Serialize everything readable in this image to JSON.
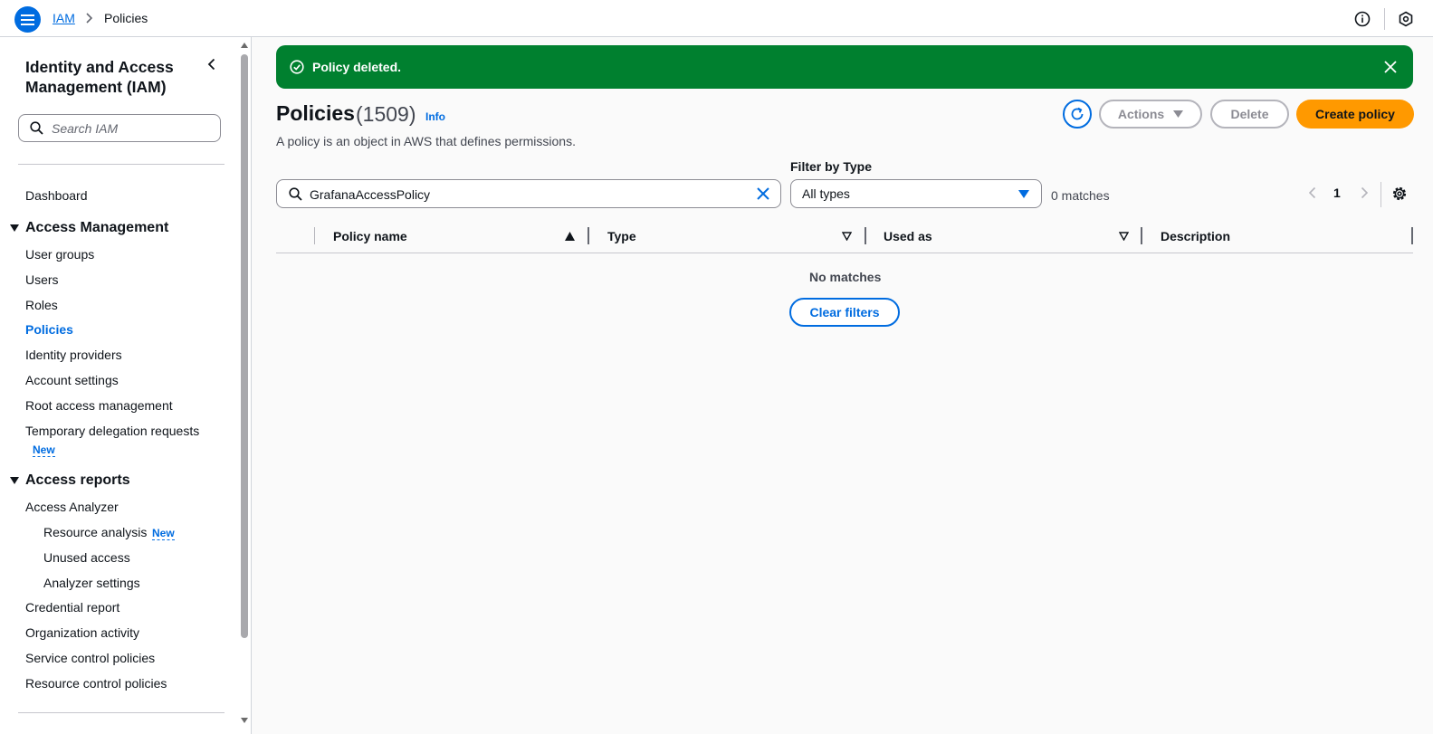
{
  "topbar": {
    "breadcrumb_root": "IAM",
    "breadcrumb_current": "Policies"
  },
  "sidebar": {
    "title": "Identity and Access Management (IAM)",
    "search_placeholder": "Search IAM",
    "dashboard": "Dashboard",
    "access_management": {
      "label": "Access Management",
      "items": [
        "User groups",
        "Users",
        "Roles",
        "Policies",
        "Identity providers",
        "Account settings",
        "Root access management",
        "Temporary delegation requests"
      ],
      "active": "Policies",
      "new_badge": "New"
    },
    "access_reports": {
      "label": "Access reports",
      "analyzer": "Access Analyzer",
      "analyzer_items": [
        "Resource analysis",
        "Unused access",
        "Analyzer settings"
      ],
      "new_badge": "New",
      "items": [
        "Credential report",
        "Organization activity",
        "Service control policies",
        "Resource control policies"
      ]
    }
  },
  "flash": {
    "message": "Policy deleted.",
    "type": "success",
    "color": "#00802f"
  },
  "header": {
    "title": "Policies",
    "count": "(1509)",
    "info": "Info",
    "description": "A policy is an object in AWS that defines permissions.",
    "actions_label": "Actions",
    "delete_label": "Delete",
    "create_label": "Create policy"
  },
  "filter": {
    "search_value": "GrafanaAccessPolicy",
    "type_label": "Filter by Type",
    "type_value": "All types",
    "matches": "0 matches",
    "page": "1"
  },
  "table": {
    "columns": [
      "Policy name",
      "Type",
      "Used as",
      "Description"
    ],
    "empty_text": "No matches",
    "clear_filters": "Clear filters"
  },
  "colors": {
    "accent": "#006ce0",
    "primary_button": "#ff9900",
    "success": "#00802f"
  }
}
